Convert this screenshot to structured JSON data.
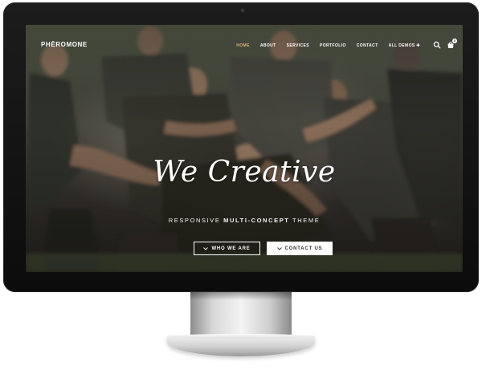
{
  "brand": {
    "logo": "PHĒROMONE"
  },
  "nav": {
    "items": [
      {
        "label": "HOME",
        "active": true
      },
      {
        "label": "ABOUT",
        "active": false
      },
      {
        "label": "SERVICES",
        "active": false
      },
      {
        "label": "PORTFOLIO",
        "active": false
      },
      {
        "label": "CONTACT",
        "active": false
      },
      {
        "label": "ALL DEMOS ✚",
        "active": false
      }
    ],
    "cart_count": "0",
    "icons": {
      "search": "search-icon",
      "cart": "shopping-bag-icon"
    }
  },
  "hero": {
    "title": "We Creative",
    "subtitle_pre": "RESPONSIVE",
    "subtitle_bold": "MULTI-CONCEPT",
    "subtitle_post": "THEME",
    "buttons": {
      "who_we_are": "WHO WE ARE",
      "contact_us": "CONTACT US"
    }
  },
  "colors": {
    "accent": "#d9b27a",
    "text": "#ffffff",
    "bezel": "#111111"
  }
}
